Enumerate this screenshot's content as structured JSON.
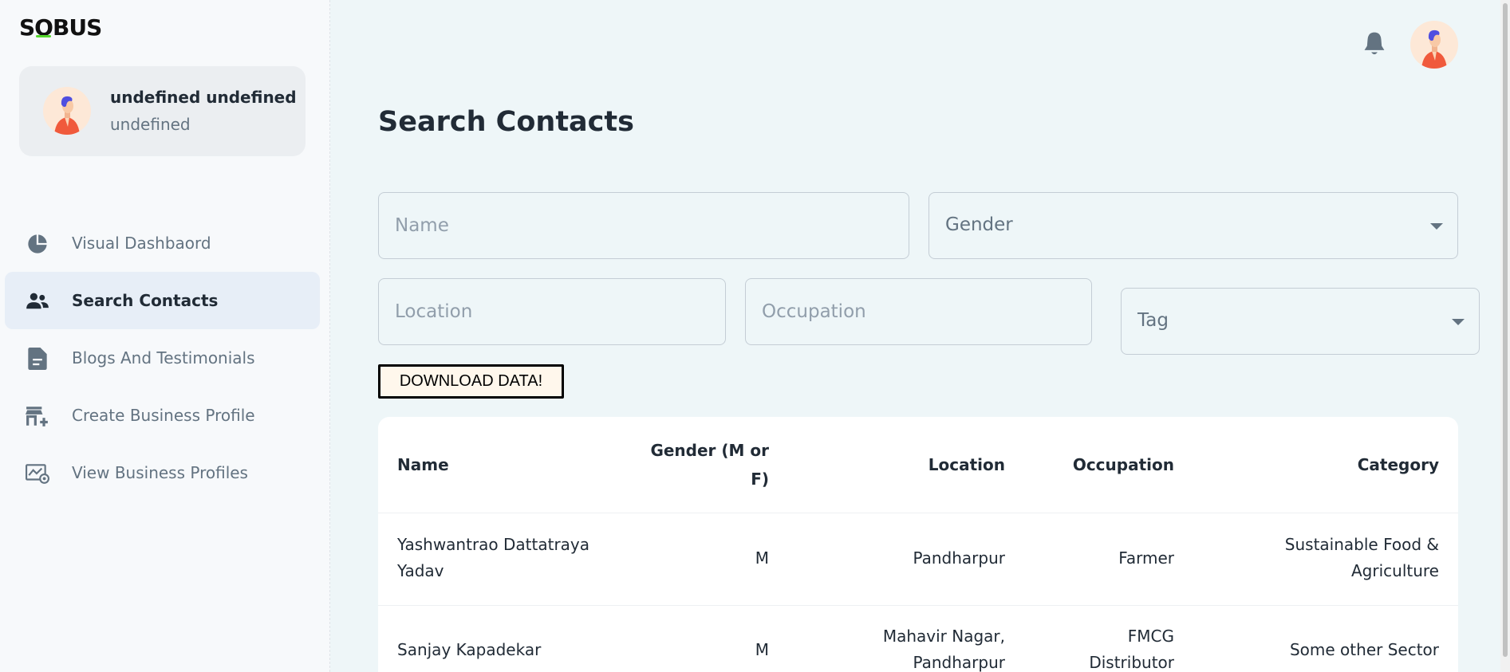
{
  "app": {
    "logo_left": "S",
    "logo_accent": "O",
    "logo_right": "BUS"
  },
  "account": {
    "name": "undefined undefined",
    "role": "undefined"
  },
  "sidebar": {
    "items": [
      {
        "label": "Visual Dashbaord",
        "icon": "pie-chart-icon",
        "active": false
      },
      {
        "label": "Search Contacts",
        "icon": "people-icon",
        "active": true
      },
      {
        "label": "Blogs And Testimonials",
        "icon": "document-icon",
        "active": false
      },
      {
        "label": "Create Business Profile",
        "icon": "add-store-icon",
        "active": false
      },
      {
        "label": "View Business Profiles",
        "icon": "monitor-view-icon",
        "active": false
      }
    ]
  },
  "header": {
    "notification_icon": "bell-icon",
    "avatar_icon": "user-avatar-icon"
  },
  "main": {
    "title": "Search Contacts",
    "filters": {
      "name_placeholder": "Name",
      "gender_placeholder": "Gender",
      "location_placeholder": "Location",
      "occupation_placeholder": "Occupation",
      "tag_placeholder": "Tag"
    },
    "download_label": "DOWNLOAD DATA!",
    "table": {
      "headers": {
        "name": "Name",
        "gender_line1": "Gender (M or",
        "gender_line2": "F)",
        "location": "Location",
        "occupation": "Occupation",
        "category": "Category"
      },
      "rows": [
        {
          "name_line1": "Yashwantrao Dattatraya",
          "name_line2": "Yadav",
          "gender": "M",
          "location_line1": "Pandharpur",
          "location_line2": "",
          "occupation_line1": "Farmer",
          "occupation_line2": "",
          "category_line1": "Sustainable Food &",
          "category_line2": "Agriculture"
        },
        {
          "name_line1": "Sanjay Kapadekar",
          "name_line2": "",
          "gender": "M",
          "location_line1": "Mahavir Nagar,",
          "location_line2": "Pandharpur",
          "occupation_line1": "FMCG",
          "occupation_line2": "Distributor",
          "category_line1": "Some other Sector",
          "category_line2": ""
        }
      ]
    }
  },
  "colors": {
    "background": "#eef6f8",
    "sidebar": "#f7f9fb",
    "active_item": "#e7eef7",
    "text_primary": "#212b36",
    "text_secondary": "#637381",
    "logo_accent": "#54d62c"
  }
}
